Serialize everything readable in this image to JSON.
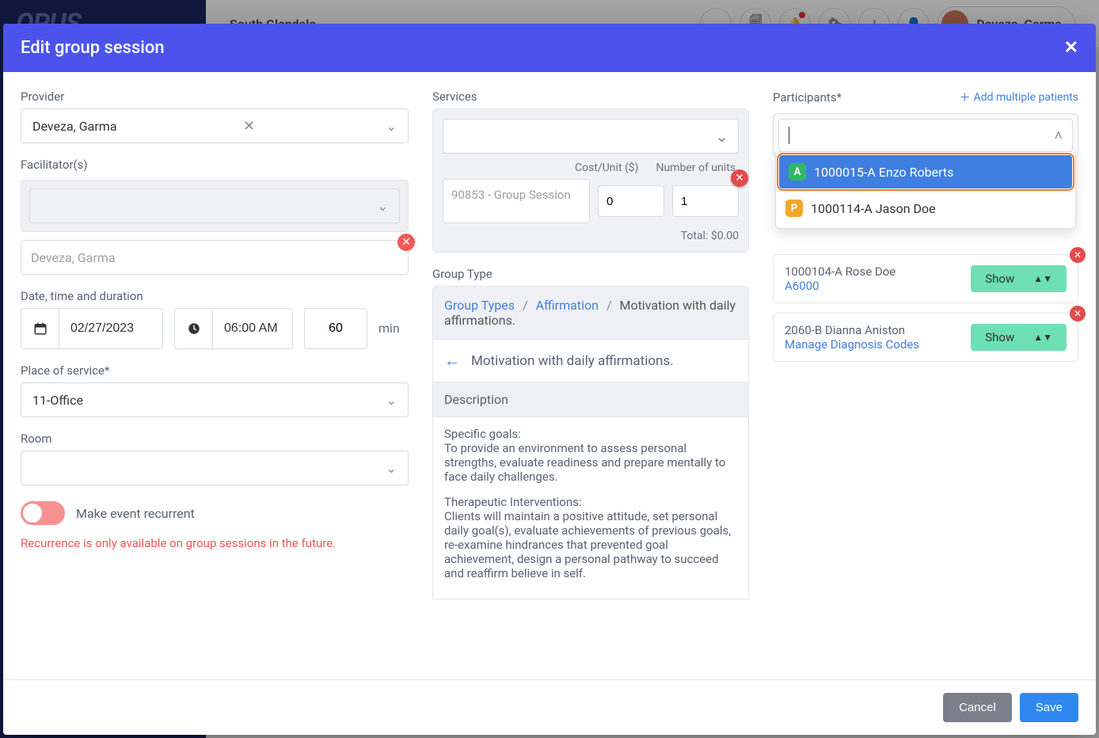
{
  "background": {
    "logo": "OPUS",
    "location": "South Glendale",
    "user_name": "Deveza, Garma"
  },
  "modal": {
    "title": "Edit group session",
    "footer": {
      "cancel": "Cancel",
      "save": "Save"
    }
  },
  "left": {
    "provider_label": "Provider",
    "provider_value": "Deveza, Garma",
    "facilitator_label": "Facilitator(s)",
    "facilitator_chip": "Deveza, Garma",
    "datetime_label": "Date, time and duration",
    "date": "02/27/2023",
    "time": "06:00 AM",
    "duration": "60",
    "min": "min",
    "place_label": "Place of service*",
    "place_value": "11-Office",
    "room_label": "Room",
    "recur_label": "Make event recurrent",
    "recur_warn": "Recurrence is only available on group sessions in the future."
  },
  "middle": {
    "services_label": "Services",
    "cost_head": "Cost/Unit ($)",
    "units_head": "Number of units",
    "svc_name": "90853 - Group Session",
    "svc_cost": "0",
    "svc_units": "1",
    "total": "Total: $0.00",
    "group_type_label": "Group Type",
    "bc1": "Group Types",
    "bc2": "Affirmation",
    "bc3": "Motivation with daily affirmations.",
    "gt_title": "Motivation with daily affirmations.",
    "desc_head": "Description",
    "desc_p1_head": "Specific goals:",
    "desc_p1": "To provide an environment to assess personal strengths, evaluate readiness and prepare mentally to face daily challenges.",
    "desc_p2_head": "Therapeutic Interventions:",
    "desc_p2": "Clients will maintain a positive attitude, set personal daily goal(s), evaluate achievements of previous goals, re-examine hindrances that prevented goal achievement, design a personal pathway to succeed and reaffirm believe in self."
  },
  "right": {
    "participants_label": "Participants*",
    "add_multiple": "Add multiple patients",
    "dd": [
      {
        "badge": "A",
        "text": "1000015-A Enzo Roberts"
      },
      {
        "badge": "P",
        "text": "1000114-A Jason Doe"
      }
    ],
    "cards": [
      {
        "name": "1000104-A Rose Doe",
        "sub": "A6000",
        "show": "Show"
      },
      {
        "name": "2060-B Dianna Aniston",
        "sub": "Manage Diagnosis Codes",
        "show": "Show"
      }
    ]
  }
}
